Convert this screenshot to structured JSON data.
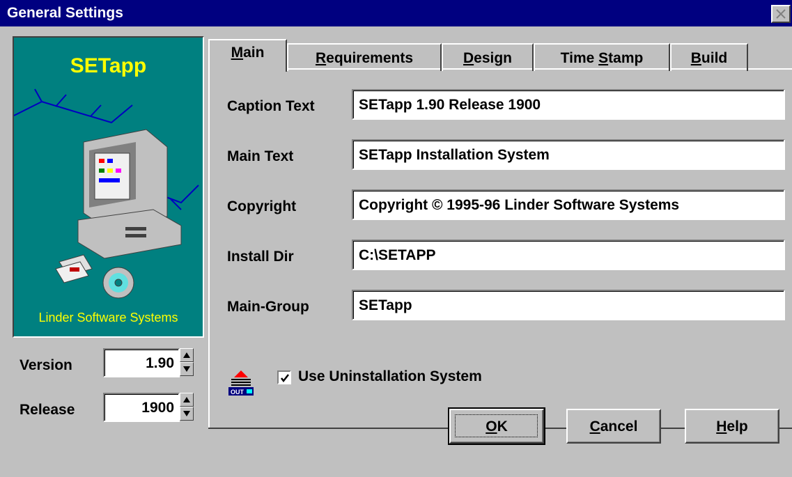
{
  "window": {
    "title": "General Settings"
  },
  "logo": {
    "product": "SETapp",
    "company": "Linder Software Systems"
  },
  "version": {
    "label": "Version",
    "value": "1.90"
  },
  "release": {
    "label": "Release",
    "value": "1900"
  },
  "tabs": [
    {
      "label": "Main",
      "accel": "M",
      "active": true
    },
    {
      "label": "Requirements",
      "accel": "R",
      "active": false
    },
    {
      "label": "Design",
      "accel": "D",
      "active": false
    },
    {
      "label": "Time Stamp",
      "accel": "S",
      "active": false
    },
    {
      "label": "Build",
      "accel": "B",
      "active": false
    }
  ],
  "fields": [
    {
      "label": "Caption Text",
      "value": "SETapp 1.90 Release 1900"
    },
    {
      "label": "Main Text",
      "value": "SETapp Installation System"
    },
    {
      "label": "Copyright",
      "value": "Copyright © 1995-96 Linder Software Systems"
    },
    {
      "label": "Install Dir",
      "value": "C:\\SETAPP"
    },
    {
      "label": "Main-Group",
      "value": "SETapp"
    }
  ],
  "uninstall": {
    "label": "Use Uninstallation System",
    "checked": true,
    "icon": "uninstall-icon",
    "icon_text": "OUT"
  },
  "buttons": {
    "ok": {
      "label": "OK",
      "accel": "O"
    },
    "cancel": {
      "label": "Cancel",
      "accel": "C"
    },
    "help": {
      "label": "Help",
      "accel": "H"
    }
  }
}
